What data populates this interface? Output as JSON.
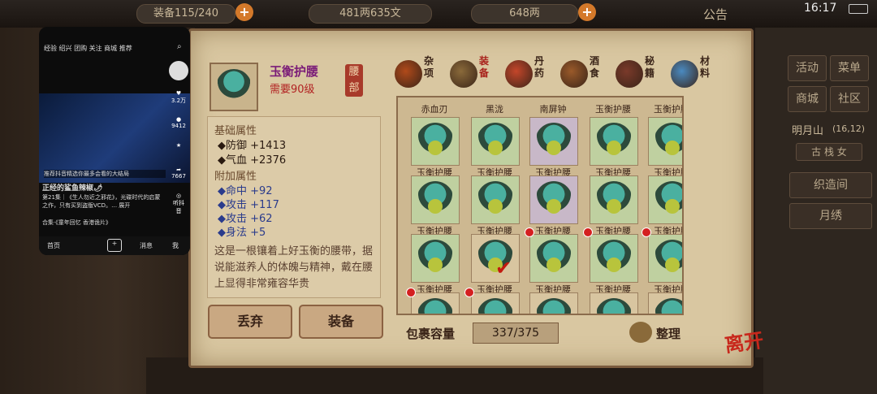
{
  "hud": {
    "bag_count": "装备115/240",
    "copper": "481两635文",
    "silver": "648两",
    "notice": "公告",
    "time": "16:17"
  },
  "right_menu": {
    "activity": "活动",
    "menu": "菜单",
    "shop": "商城",
    "community": "社区",
    "location": "明月山",
    "coords": "(16,12)",
    "tag": "古 栈 女",
    "weave": "织造间",
    "embroidery": "月绣"
  },
  "item": {
    "name": "玉衡护腰",
    "requirement": "需要90级",
    "slot": "腰部",
    "base_title": "基础属性",
    "base_attrs": [
      {
        "label": "◆防御",
        "value": "+1413"
      },
      {
        "label": "◆气血",
        "value": "+2376"
      }
    ],
    "extra_title": "附加属性",
    "extra_attrs": [
      {
        "label": "◆命中",
        "value": "+92"
      },
      {
        "label": "◆攻击",
        "value": "+117"
      },
      {
        "label": "◆攻击",
        "value": "+62"
      },
      {
        "label": "◆身法",
        "value": "+5"
      }
    ],
    "description": "这是一根镶着上好玉衡的腰带，据说能滋养人的体魄与精神，戴在腰上显得非常雍容华贵"
  },
  "buttons": {
    "discard": "丢弃",
    "equip": "装备",
    "sort": "整理",
    "leave": "离开"
  },
  "tabs": [
    {
      "label": "杂项",
      "color": "#b04a1a"
    },
    {
      "label": "装备",
      "color": "#8a6a3a",
      "active": true
    },
    {
      "label": "丹药",
      "color": "#c4462a"
    },
    {
      "label": "酒食",
      "color": "#9a5a2a"
    },
    {
      "label": "秘籍",
      "color": "#7a3a2a"
    },
    {
      "label": "材料",
      "color": "#4a8ac0"
    }
  ],
  "top_labels": [
    "赤血刃",
    "黑泷",
    "南屏钟",
    "玉衡护腰",
    "玉衡护腰"
  ],
  "grid_rows": [
    [
      "玉衡护腰",
      "玉衡护腰",
      "玉衡护腰",
      "玉衡护腰",
      "玉衡护腰"
    ],
    [
      "玉衡护腰",
      "玉衡护腰",
      "玉衡护腰",
      "玉衡护腰",
      "玉衡护腰"
    ],
    [
      "玉衡护腰",
      "玉衡护腰",
      "玉衡护腰",
      "玉衡护腰",
      "玉衡护腰"
    ]
  ],
  "capacity": {
    "label": "包裹容量",
    "value": "337/375"
  },
  "phone": {
    "nav": "经验  绍兴  团购  关注  商城  推荐",
    "likes": "3.2万",
    "comments": "9412",
    "shares": "7667",
    "author": "正经的鲨鱼辣椒🌶",
    "desc": "第21集｜《生人勿近之邪花》，光碟时代的启蒙之作，只有买到盗版VCD。… 展开",
    "caption": "推荐抖音精选你最多会看的大结局",
    "collection": "合集·《童年回忆 香港诡片》",
    "bottom": [
      "首页",
      "",
      "+",
      "消息",
      "我"
    ],
    "listen": "听抖音"
  }
}
